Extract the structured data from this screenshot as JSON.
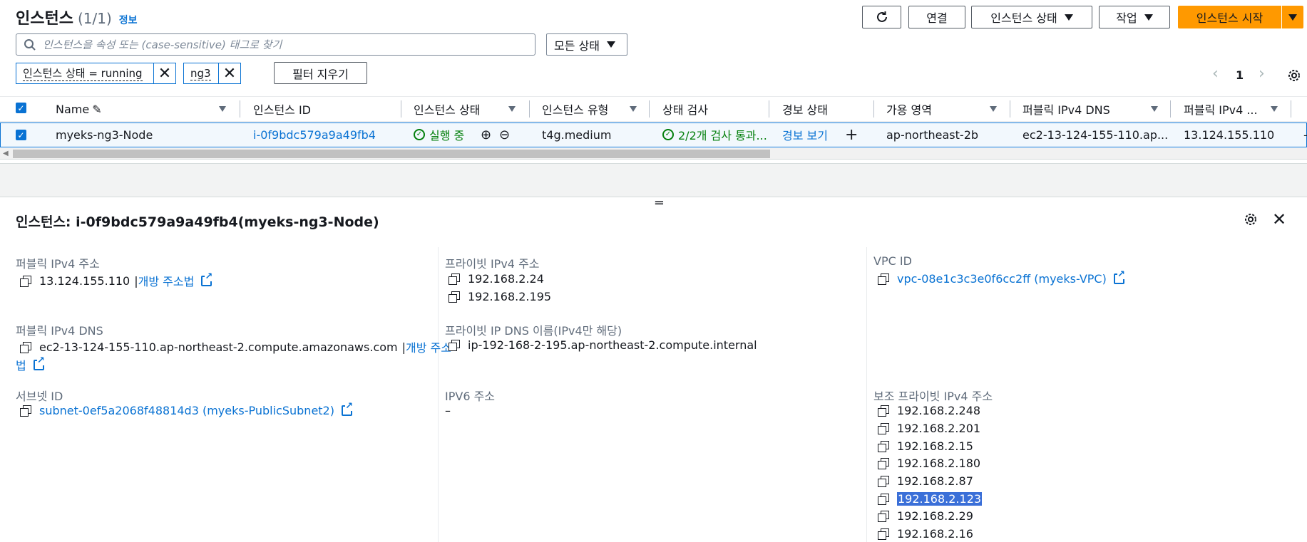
{
  "header": {
    "title": "인스턴스",
    "count": "(1/1)",
    "info": "정보",
    "buttons": {
      "connect": "연결",
      "instance_state": "인스턴스 상태",
      "actions": "작업",
      "launch": "인스턴스 시작"
    }
  },
  "search": {
    "placeholder": "인스턴스을 속성 또는 (case-sensitive) 태그로 찾기"
  },
  "state_filter": {
    "value": "모든 상태"
  },
  "filters": {
    "chip1": "인스턴스 상태 = running",
    "chip2": "ng3",
    "clear": "필터 지우기"
  },
  "pagination": {
    "page": "1"
  },
  "table": {
    "columns": {
      "name": "Name",
      "instance_id": "인스턴스 ID",
      "instance_state": "인스턴스 상태",
      "instance_type": "인스턴스 유형",
      "status_check": "상태 검사",
      "alarm_state": "경보 상태",
      "availability_zone": "가용 영역",
      "public_dns": "퍼블릭 IPv4 DNS",
      "public_ip": "퍼블릭 IPv4 ..."
    },
    "row": {
      "name": "myeks-ng3-Node",
      "instance_id": "i-0f9bdc579a9a49fb4",
      "state": "실행 중",
      "type": "t4g.medium",
      "status_check": "2/2개 검사 통과...",
      "alarm": "경보 보기",
      "az": "ap-northeast-2b",
      "public_dns": "ec2-13-124-155-110.ap...",
      "public_ip": "13.124.155.110",
      "dash": "–"
    }
  },
  "details": {
    "title": "인스턴스: i-0f9bdc579a9a49fb4(myeks-ng3-Node)",
    "public_ip": {
      "label": "퍼블릭 IPv4 주소",
      "value": "13.124.155.110",
      "sep": "|",
      "link": "개방 주소법"
    },
    "public_dns": {
      "label": "퍼블릭 IPv4 DNS",
      "value": "ec2-13-124-155-110.ap-northeast-2.compute.amazonaws.com",
      "sep": "|",
      "link1": "개방 주소",
      "link2": "법"
    },
    "subnet": {
      "label": "서브넷 ID",
      "value": "subnet-0ef5a2068f48814d3 (myeks-PublicSubnet2)"
    },
    "private_ip": {
      "label": "프라이빗 IPv4 주소",
      "values": [
        "192.168.2.24",
        "192.168.2.195"
      ]
    },
    "private_dns": {
      "label": "프라이빗 IP DNS 이름(IPv4만 해당)",
      "value": "ip-192-168-2-195.ap-northeast-2.compute.internal"
    },
    "ipv6": {
      "label": "IPV6 주소",
      "value": "–"
    },
    "vpc": {
      "label": "VPC ID",
      "value": "vpc-08e1c3c3e0f6cc2ff (myeks-VPC)"
    },
    "secondary": {
      "label": "보조 프라이빗 IPv4 주소",
      "values": [
        "192.168.2.248",
        "192.168.2.201",
        "192.168.2.15",
        "192.168.2.180",
        "192.168.2.87",
        "192.168.2.123",
        "192.168.2.29",
        "192.168.2.16"
      ]
    }
  },
  "colors": {
    "primary": "#ff9900",
    "link": "#0972d3",
    "success": "#037f0c",
    "highlight": "#3a6fd8"
  }
}
